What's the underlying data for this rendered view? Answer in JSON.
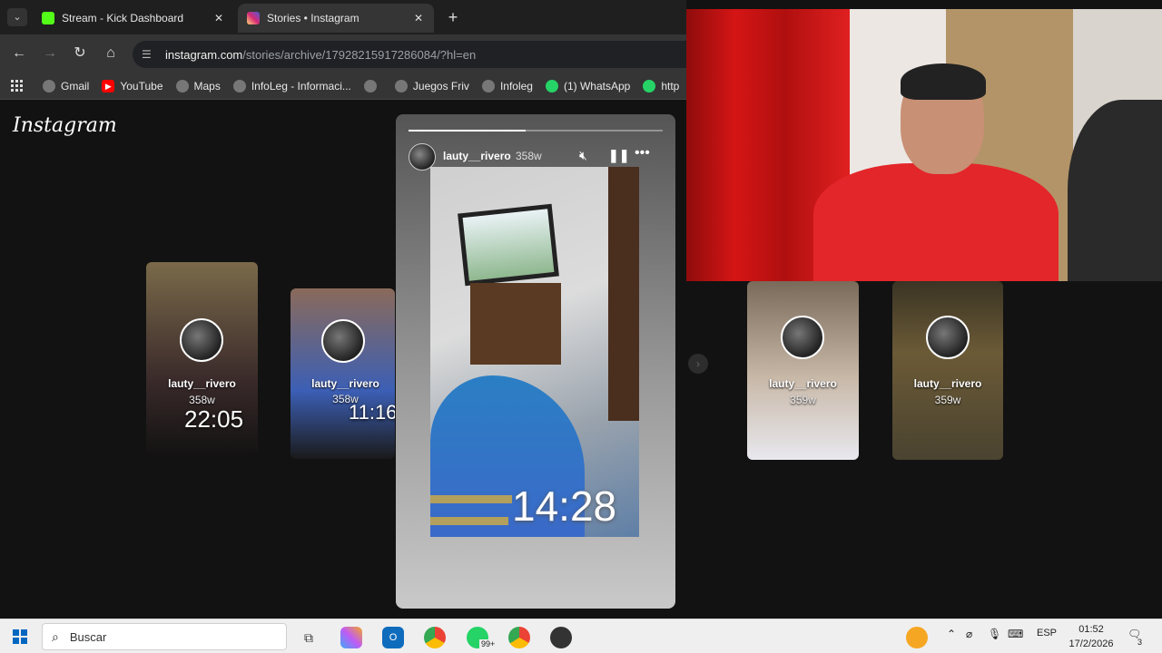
{
  "browser": {
    "tabs": [
      {
        "title": "Stream - Kick Dashboard",
        "favicon": "kick-icon",
        "color": "#53fc18"
      },
      {
        "title": "Stories • Instagram",
        "favicon": "instagram-icon",
        "color": "#d62976"
      }
    ],
    "new_tab": "+",
    "url_host": "instagram.com",
    "url_path": "/stories/archive/17928215917286084/?hl=en",
    "bookmarks": [
      "Gmail",
      "YouTube",
      "Maps",
      "InfoLeg - Informaci...",
      "",
      "Juegos Friv",
      "Infoleg",
      "(1) WhatsApp",
      "http"
    ]
  },
  "instagram": {
    "logo": "Instagram",
    "story": {
      "user": "lauty__rivero",
      "age": "358w",
      "clock": "14:28",
      "progress": 0.46
    },
    "side_stories": [
      {
        "user": "lauty__rivero",
        "age": "358w",
        "clock": "22:05"
      },
      {
        "user": "lauty__rivero",
        "age": "358w",
        "clock": "11:16"
      },
      {
        "user": "lauty__rivero",
        "age": "359w",
        "clock": ""
      },
      {
        "user": "lauty__rivero",
        "age": "359w",
        "clock": ""
      }
    ]
  },
  "taskbar": {
    "search_placeholder": "Buscar",
    "badge": "99+",
    "language": "ESP",
    "time": "01:52",
    "date": "17/2/2026",
    "notif_count": "3"
  }
}
